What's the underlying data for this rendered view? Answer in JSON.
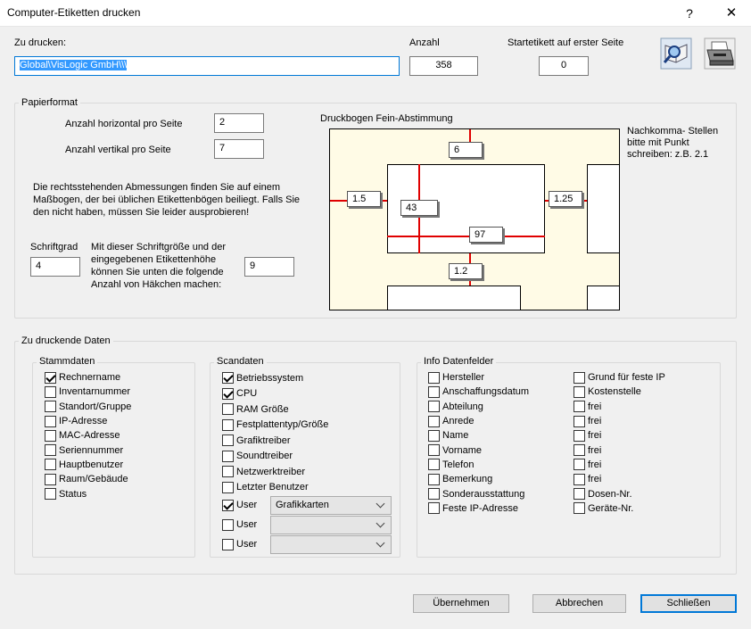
{
  "window": {
    "title": "Computer-Etiketten drucken",
    "help": "?",
    "close": "✕"
  },
  "top": {
    "to_print_label": "Zu drucken:",
    "to_print_value": "Global\\VisLogic GmbH\\\\\\",
    "count_label": "Anzahl",
    "count_value": "358",
    "start_label": "Startetikett auf erster Seite",
    "start_value": "0",
    "preview_icon": "print-preview-icon",
    "printer_icon": "printer-icon"
  },
  "paper": {
    "title": "Papierformat",
    "horiz_label": "Anzahl horizontal pro Seite",
    "horiz_value": "2",
    "vert_label": "Anzahl vertikal pro Seite",
    "vert_value": "7",
    "info_text": "Die rechtsstehenden Abmessungen finden Sie auf einem Maßbogen, der bei üblichen Etikettenbögen beiliegt. Falls Sie den nicht haben, müssen Sie leider ausprobieren!",
    "font_label": "Schriftgrad",
    "font_value": "4",
    "hooks_text": "Mit dieser Schriftgröße und der eingegebenen Etikettenhöhe können Sie unten die folgende Anzahl von Häkchen machen:",
    "hooks_value": "9",
    "fine_title": "Druckbogen Fein-Abstimmung",
    "fine": {
      "top": "6",
      "left": "1.5",
      "width": "43",
      "right": "1.25",
      "height": "97",
      "gap": "1.2"
    },
    "note": "Nachkomma- Stellen bitte mit Punkt schreiben:  z.B. 2.1"
  },
  "data": {
    "title": "Zu druckende Daten",
    "stamm": {
      "title": "Stammdaten",
      "items": [
        {
          "label": "Rechnername",
          "checked": true
        },
        {
          "label": "Inventarnummer",
          "checked": false
        },
        {
          "label": "Standort/Gruppe",
          "checked": false
        },
        {
          "label": "IP-Adresse",
          "checked": false
        },
        {
          "label": "MAC-Adresse",
          "checked": false
        },
        {
          "label": "Seriennummer",
          "checked": false
        },
        {
          "label": "Hauptbenutzer",
          "checked": false
        },
        {
          "label": "Raum/Gebäude",
          "checked": false
        },
        {
          "label": "Status",
          "checked": false
        }
      ]
    },
    "scan": {
      "title": "Scandaten",
      "items": [
        {
          "label": "Betriebssystem",
          "checked": true
        },
        {
          "label": "CPU",
          "checked": true
        },
        {
          "label": "RAM Größe",
          "checked": false
        },
        {
          "label": "Festplattentyp/Größe",
          "checked": false
        },
        {
          "label": "Grafiktreiber",
          "checked": false
        },
        {
          "label": "Soundtreiber",
          "checked": false
        },
        {
          "label": "Netzwerktreiber",
          "checked": false
        },
        {
          "label": "Letzter Benutzer",
          "checked": false
        }
      ],
      "user_rows": [
        {
          "label": "User",
          "checked": true,
          "value": "Grafikkarten"
        },
        {
          "label": "User",
          "checked": false,
          "value": ""
        },
        {
          "label": "User",
          "checked": false,
          "value": ""
        }
      ]
    },
    "info": {
      "title": "Info Datenfelder",
      "col1": [
        {
          "label": "Hersteller",
          "checked": false
        },
        {
          "label": "Anschaffungsdatum",
          "checked": false
        },
        {
          "label": "Abteilung",
          "checked": false
        },
        {
          "label": "Anrede",
          "checked": false
        },
        {
          "label": "Name",
          "checked": false
        },
        {
          "label": "Vorname",
          "checked": false
        },
        {
          "label": "Telefon",
          "checked": false
        },
        {
          "label": "Bemerkung",
          "checked": false
        },
        {
          "label": "Sonderausstattung",
          "checked": false
        },
        {
          "label": "Feste IP-Adresse",
          "checked": false
        }
      ],
      "col2": [
        {
          "label": "Grund für feste IP",
          "checked": false
        },
        {
          "label": "Kostenstelle",
          "checked": false
        },
        {
          "label": "frei",
          "checked": false
        },
        {
          "label": "frei",
          "checked": false
        },
        {
          "label": "frei",
          "checked": false
        },
        {
          "label": "frei",
          "checked": false
        },
        {
          "label": "frei",
          "checked": false
        },
        {
          "label": "frei",
          "checked": false
        },
        {
          "label": "Dosen-Nr.",
          "checked": false
        },
        {
          "label": "Geräte-Nr.",
          "checked": false
        }
      ]
    }
  },
  "buttons": {
    "apply": "Übernehmen",
    "cancel": "Abbrechen",
    "close": "Schließen"
  }
}
